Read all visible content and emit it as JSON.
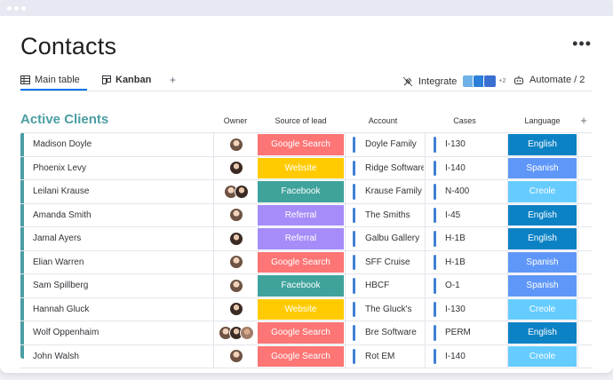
{
  "page": {
    "title": "Contacts",
    "more_label": "•••"
  },
  "tabs": {
    "main": "Main table",
    "kanban": "Kanban",
    "add": "+"
  },
  "toolbar": {
    "integrate": "Integrate",
    "integrate_more": "+2",
    "automate": "Automate / 2"
  },
  "group": {
    "title": "Active Clients",
    "accent": "#4a9ea3",
    "columns": {
      "owner": "Owner",
      "source": "Source of lead",
      "account": "Account",
      "cases": "Cases",
      "language": "Language",
      "add": "+"
    }
  },
  "colors": {
    "Google Search": "#fd7575",
    "Website": "#ffcb00",
    "Facebook": "#3fa39c",
    "Referral": "#a58cf8",
    "English": "#0c82c5",
    "Spanish": "#5f97f8",
    "Creole": "#66ccff"
  },
  "rows": [
    {
      "name": "Madison Doyle",
      "owners": 1,
      "source": "Google Search",
      "account": "Doyle Family",
      "cases": "I-130",
      "language": "English"
    },
    {
      "name": "Phoenix Levy",
      "owners": 1,
      "source": "Website",
      "account": "Ridge Software",
      "cases": "I-140",
      "language": "Spanish"
    },
    {
      "name": "Leilani Krause",
      "owners": 2,
      "source": "Facebook",
      "account": "Krause Family",
      "cases": "N-400",
      "language": "Creole"
    },
    {
      "name": "Amanda Smith",
      "owners": 1,
      "source": "Referral",
      "account": "The Smiths",
      "cases": "I-45",
      "language": "English"
    },
    {
      "name": "Jamal Ayers",
      "owners": 1,
      "source": "Referral",
      "account": "Galbu Gallery",
      "cases": "H-1B",
      "language": "English"
    },
    {
      "name": "Elian Warren",
      "owners": 1,
      "source": "Google Search",
      "account": "SFF Cruise",
      "cases": "H-1B",
      "language": "Spanish"
    },
    {
      "name": "Sam Spillberg",
      "owners": 1,
      "source": "Facebook",
      "account": "HBCF",
      "cases": "O-1",
      "language": "Spanish"
    },
    {
      "name": "Hannah Gluck",
      "owners": 1,
      "source": "Website",
      "account": "The Gluck's",
      "cases": "I-130",
      "language": "Creole"
    },
    {
      "name": "Wolf Oppenhaim",
      "owners": 3,
      "source": "Google Search",
      "account": "Bre Software",
      "cases": "PERM",
      "language": "English"
    },
    {
      "name": "John Walsh",
      "owners": 1,
      "source": "Google Search",
      "account": "Rot EM",
      "cases": "I-140",
      "language": "Creole"
    }
  ]
}
